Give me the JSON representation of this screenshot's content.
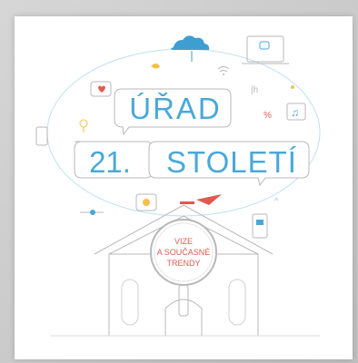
{
  "cover": {
    "title_line1": "ÚŘAD",
    "title_line2_num": "21.",
    "title_line2_word": "STOLETÍ",
    "badge_line1": "VIZE",
    "badge_line2": "A SOUČASNÉ",
    "badge_line3": "TRENDY"
  },
  "colors": {
    "accent_blue": "#4aa8d8",
    "accent_red": "#e05a4f",
    "line_gray": "#b8b8b8",
    "light_teal": "#9fd3e8"
  },
  "icons": [
    "cloud-icon",
    "heart-icon",
    "wifi-icon",
    "laptop-icon",
    "music-note-icon",
    "phone-icon",
    "lightbulb-icon",
    "paper-plane-icon",
    "smiley-icon",
    "magnifying-glass-icon",
    "building-icon",
    "tablet-icon"
  ]
}
